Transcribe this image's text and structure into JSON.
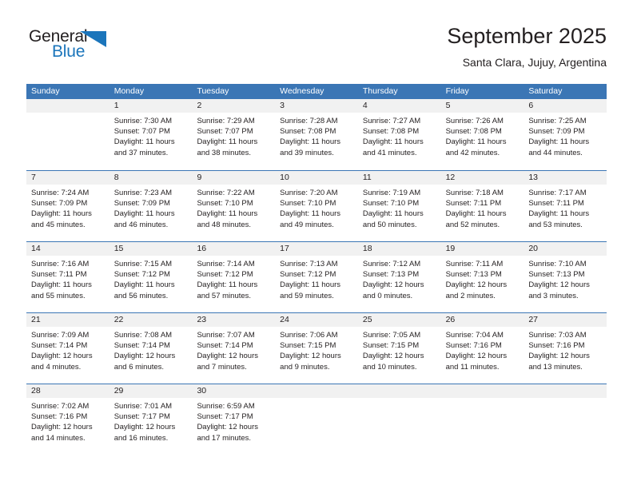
{
  "brand": {
    "name_part1": "General",
    "name_part2": "Blue",
    "accent_color": "#1b75bb",
    "triangle_icon": "triangle-icon"
  },
  "header": {
    "month_title": "September 2025",
    "location": "Santa Clara, Jujuy, Argentina"
  },
  "calendar": {
    "header_bg": "#3b76b5",
    "day_band_bg": "#f1f1f1",
    "weekdays": [
      "Sunday",
      "Monday",
      "Tuesday",
      "Wednesday",
      "Thursday",
      "Friday",
      "Saturday"
    ],
    "weeks": [
      [
        {
          "day": "",
          "lines": []
        },
        {
          "day": "1",
          "lines": [
            "Sunrise: 7:30 AM",
            "Sunset: 7:07 PM",
            "Daylight: 11 hours",
            "and 37 minutes."
          ]
        },
        {
          "day": "2",
          "lines": [
            "Sunrise: 7:29 AM",
            "Sunset: 7:07 PM",
            "Daylight: 11 hours",
            "and 38 minutes."
          ]
        },
        {
          "day": "3",
          "lines": [
            "Sunrise: 7:28 AM",
            "Sunset: 7:08 PM",
            "Daylight: 11 hours",
            "and 39 minutes."
          ]
        },
        {
          "day": "4",
          "lines": [
            "Sunrise: 7:27 AM",
            "Sunset: 7:08 PM",
            "Daylight: 11 hours",
            "and 41 minutes."
          ]
        },
        {
          "day": "5",
          "lines": [
            "Sunrise: 7:26 AM",
            "Sunset: 7:08 PM",
            "Daylight: 11 hours",
            "and 42 minutes."
          ]
        },
        {
          "day": "6",
          "lines": [
            "Sunrise: 7:25 AM",
            "Sunset: 7:09 PM",
            "Daylight: 11 hours",
            "and 44 minutes."
          ]
        }
      ],
      [
        {
          "day": "7",
          "lines": [
            "Sunrise: 7:24 AM",
            "Sunset: 7:09 PM",
            "Daylight: 11 hours",
            "and 45 minutes."
          ]
        },
        {
          "day": "8",
          "lines": [
            "Sunrise: 7:23 AM",
            "Sunset: 7:09 PM",
            "Daylight: 11 hours",
            "and 46 minutes."
          ]
        },
        {
          "day": "9",
          "lines": [
            "Sunrise: 7:22 AM",
            "Sunset: 7:10 PM",
            "Daylight: 11 hours",
            "and 48 minutes."
          ]
        },
        {
          "day": "10",
          "lines": [
            "Sunrise: 7:20 AM",
            "Sunset: 7:10 PM",
            "Daylight: 11 hours",
            "and 49 minutes."
          ]
        },
        {
          "day": "11",
          "lines": [
            "Sunrise: 7:19 AM",
            "Sunset: 7:10 PM",
            "Daylight: 11 hours",
            "and 50 minutes."
          ]
        },
        {
          "day": "12",
          "lines": [
            "Sunrise: 7:18 AM",
            "Sunset: 7:11 PM",
            "Daylight: 11 hours",
            "and 52 minutes."
          ]
        },
        {
          "day": "13",
          "lines": [
            "Sunrise: 7:17 AM",
            "Sunset: 7:11 PM",
            "Daylight: 11 hours",
            "and 53 minutes."
          ]
        }
      ],
      [
        {
          "day": "14",
          "lines": [
            "Sunrise: 7:16 AM",
            "Sunset: 7:11 PM",
            "Daylight: 11 hours",
            "and 55 minutes."
          ]
        },
        {
          "day": "15",
          "lines": [
            "Sunrise: 7:15 AM",
            "Sunset: 7:12 PM",
            "Daylight: 11 hours",
            "and 56 minutes."
          ]
        },
        {
          "day": "16",
          "lines": [
            "Sunrise: 7:14 AM",
            "Sunset: 7:12 PM",
            "Daylight: 11 hours",
            "and 57 minutes."
          ]
        },
        {
          "day": "17",
          "lines": [
            "Sunrise: 7:13 AM",
            "Sunset: 7:12 PM",
            "Daylight: 11 hours",
            "and 59 minutes."
          ]
        },
        {
          "day": "18",
          "lines": [
            "Sunrise: 7:12 AM",
            "Sunset: 7:13 PM",
            "Daylight: 12 hours",
            "and 0 minutes."
          ]
        },
        {
          "day": "19",
          "lines": [
            "Sunrise: 7:11 AM",
            "Sunset: 7:13 PM",
            "Daylight: 12 hours",
            "and 2 minutes."
          ]
        },
        {
          "day": "20",
          "lines": [
            "Sunrise: 7:10 AM",
            "Sunset: 7:13 PM",
            "Daylight: 12 hours",
            "and 3 minutes."
          ]
        }
      ],
      [
        {
          "day": "21",
          "lines": [
            "Sunrise: 7:09 AM",
            "Sunset: 7:14 PM",
            "Daylight: 12 hours",
            "and 4 minutes."
          ]
        },
        {
          "day": "22",
          "lines": [
            "Sunrise: 7:08 AM",
            "Sunset: 7:14 PM",
            "Daylight: 12 hours",
            "and 6 minutes."
          ]
        },
        {
          "day": "23",
          "lines": [
            "Sunrise: 7:07 AM",
            "Sunset: 7:14 PM",
            "Daylight: 12 hours",
            "and 7 minutes."
          ]
        },
        {
          "day": "24",
          "lines": [
            "Sunrise: 7:06 AM",
            "Sunset: 7:15 PM",
            "Daylight: 12 hours",
            "and 9 minutes."
          ]
        },
        {
          "day": "25",
          "lines": [
            "Sunrise: 7:05 AM",
            "Sunset: 7:15 PM",
            "Daylight: 12 hours",
            "and 10 minutes."
          ]
        },
        {
          "day": "26",
          "lines": [
            "Sunrise: 7:04 AM",
            "Sunset: 7:16 PM",
            "Daylight: 12 hours",
            "and 11 minutes."
          ]
        },
        {
          "day": "27",
          "lines": [
            "Sunrise: 7:03 AM",
            "Sunset: 7:16 PM",
            "Daylight: 12 hours",
            "and 13 minutes."
          ]
        }
      ],
      [
        {
          "day": "28",
          "lines": [
            "Sunrise: 7:02 AM",
            "Sunset: 7:16 PM",
            "Daylight: 12 hours",
            "and 14 minutes."
          ]
        },
        {
          "day": "29",
          "lines": [
            "Sunrise: 7:01 AM",
            "Sunset: 7:17 PM",
            "Daylight: 12 hours",
            "and 16 minutes."
          ]
        },
        {
          "day": "30",
          "lines": [
            "Sunrise: 6:59 AM",
            "Sunset: 7:17 PM",
            "Daylight: 12 hours",
            "and 17 minutes."
          ]
        },
        {
          "day": "",
          "lines": []
        },
        {
          "day": "",
          "lines": []
        },
        {
          "day": "",
          "lines": []
        },
        {
          "day": "",
          "lines": []
        }
      ]
    ]
  }
}
